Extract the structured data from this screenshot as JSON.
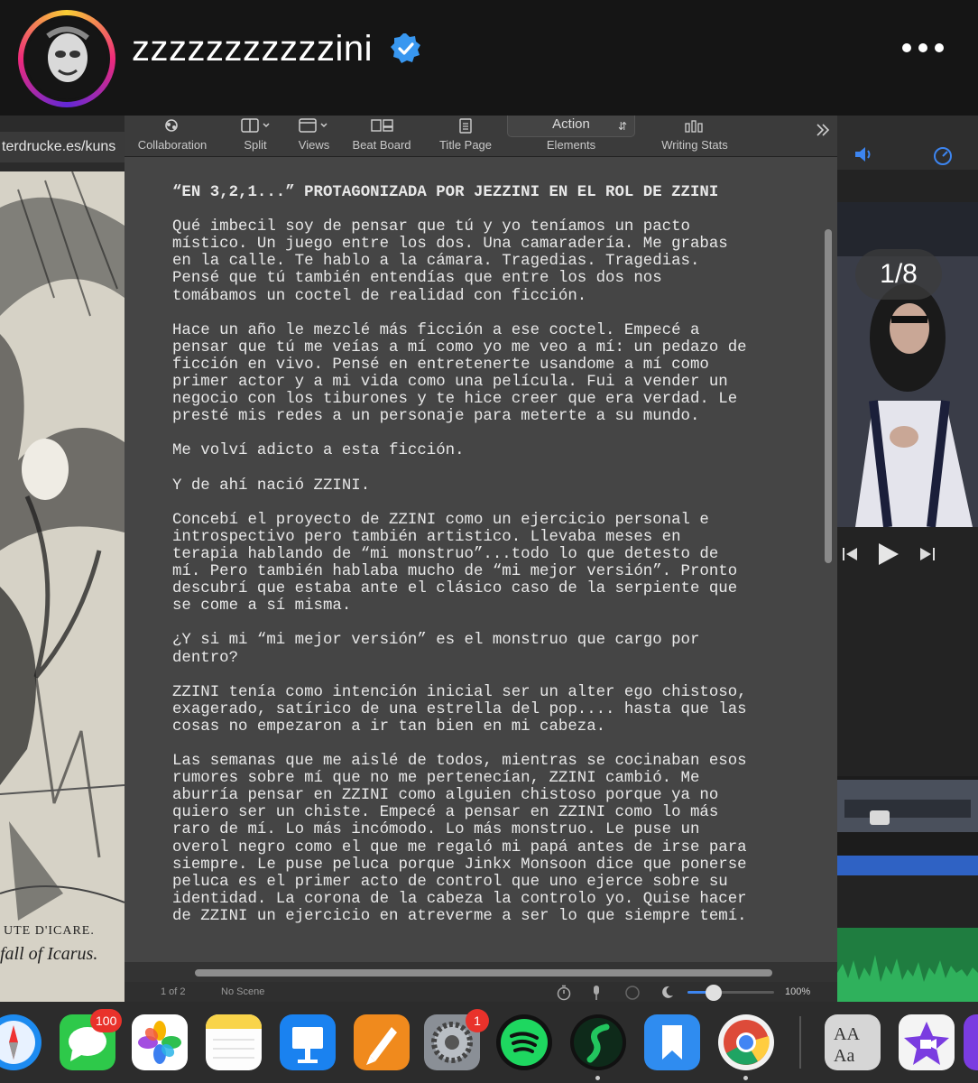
{
  "ig": {
    "username": "zzzzzzzzzzzini",
    "more_label": "•••"
  },
  "browser": {
    "url_fragment": "terdrucke.es/kuns",
    "caption_line1": "UTE D'ICARE.",
    "caption_line2": "fall of Icarus."
  },
  "toolbar": {
    "items": [
      {
        "label": "Collaboration",
        "icon": "collaboration-icon"
      },
      {
        "label": "Split",
        "icon": "split-icon"
      },
      {
        "label": "Views",
        "icon": "views-icon"
      },
      {
        "label": "Beat Board",
        "icon": "beat-board-icon"
      },
      {
        "label": "Title Page",
        "icon": "title-page-icon"
      },
      {
        "label": "Elements",
        "icon": "elements-select"
      },
      {
        "label": "Writing Stats",
        "icon": "writing-stats-icon"
      }
    ],
    "elements_value": "Action"
  },
  "script": {
    "title": "“EN 3,2,1...” PROTAGONIZADA POR JEZZINI EN EL ROL DE ZZINI",
    "paragraphs": [
      [
        "Qué imbecil soy de pensar que tú y yo teníamos un pacto",
        "místico. Un juego entre los dos. Una camaradería. Me grabas",
        "en la calle. Te hablo a la cámara. Tragedias. Tragedias.",
        "Pensé que tú también entendías que entre los dos nos",
        "tomábamos un coctel de realidad con ficción."
      ],
      [
        "Hace un año le mezclé más ficción a ese coctel. Empecé a",
        "pensar que tú me veías a mí como yo me veo a mí: un pedazo de",
        "ficción en vivo. Pensé en entretenerte usandome a mí como",
        "primer actor y a mi vida como una película. Fui a vender un",
        "negocio con los tiburones y te hice creer que era verdad. Le",
        "presté mis redes a un personaje para meterte a su mundo."
      ],
      [
        "Me volví adicto a esta ficción."
      ],
      [
        "Y de ahí nació ZZINI."
      ],
      [
        "Concebí el proyecto de ZZINI como un ejercicio personal e",
        "introspectivo pero también artistico. Llevaba meses en",
        "terapia hablando de “mi monstruo”...todo lo que detesto de",
        "mí. Pero también hablaba mucho de “mi mejor versión”. Pronto",
        "descubrí que estaba ante el clásico caso de la serpiente que",
        "se come a sí misma."
      ],
      [
        "¿Y si mi “mi mejor versión” es el monstruo que cargo por",
        "dentro?"
      ],
      [
        "ZZINI tenía como intención inicial ser un alter ego chistoso,",
        "exagerado, satírico de una estrella del pop.... hasta que las",
        "cosas no empezaron a ir tan bien en mi cabeza."
      ],
      [
        "Las semanas que me aislé de todos, mientras se cocinaban esos",
        "rumores sobre mí que no me pertenecían, ZZINI cambió. Me",
        "aburría pensar en ZZINI como alguien chistoso porque ya no",
        "quiero ser un chiste. Empecé a pensar en ZZINI como lo más",
        "raro de mí. Lo más incómodo. Lo más monstruo. Le puse un",
        "overol negro como el que me regaló mi papá antes de irse para",
        "siempre. Le puse peluca porque Jinkx Monsoon dice que ponerse",
        "peluca es el primer acto de control que uno ejerce sobre su",
        "identidad. La corona de la cabeza la controlo yo. Quise hacer",
        "de ZZINI un ejercicio en atreverme a ser lo que siempre temí."
      ]
    ]
  },
  "status": {
    "page_count": "1 of 2",
    "scene": "No Scene",
    "zoom": "100%",
    "zoom_fraction": 0.3
  },
  "media": {
    "slide_counter": "1/8"
  },
  "dock": {
    "messages_badge": "100",
    "settings_badge": "1",
    "apps": [
      "safari-icon",
      "messages-icon",
      "photos-icon",
      "notes-icon",
      "keynote-icon",
      "pages-icon",
      "system-settings-icon",
      "spotify-icon",
      "final-draft-icon",
      "bookmarks-icon",
      "chrome-icon",
      "font-book-icon",
      "imovie-icon"
    ]
  },
  "colors": {
    "verified": "#3897f0",
    "doc_bg": "#454545",
    "text": "#e8e8e8",
    "badge": "#e9322b"
  }
}
